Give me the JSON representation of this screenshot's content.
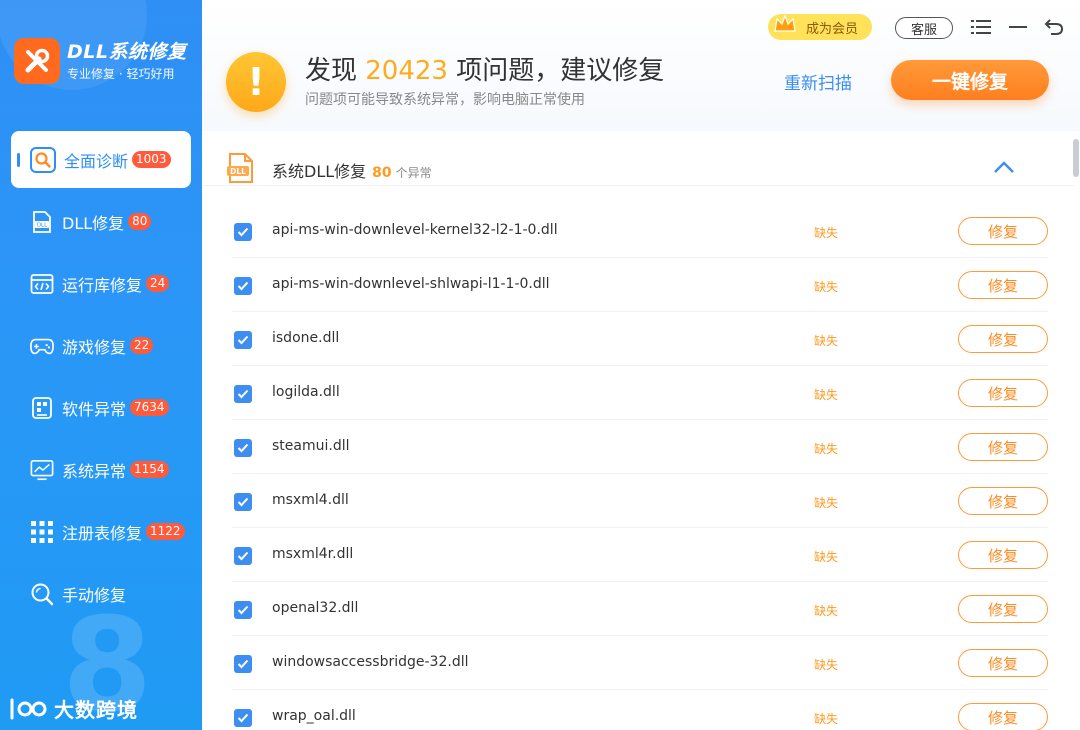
{
  "app": {
    "title": "DLL系统修复",
    "subtitle": "专业修复 · 轻巧好用"
  },
  "colors": {
    "sidebar": "#2f8ff5",
    "accent_orange": "#ff8a1f",
    "badge_red": "#ff5a3c",
    "link_blue": "#3c8ef0"
  },
  "sidebar": {
    "items": [
      {
        "label": "全面诊断",
        "badge": "1003",
        "icon": "search-icon",
        "active": true
      },
      {
        "label": "DLL修复",
        "badge": "80",
        "icon": "dll-file-icon"
      },
      {
        "label": "运行库修复",
        "badge": "24",
        "icon": "code-window-icon"
      },
      {
        "label": "游戏修复",
        "badge": "22",
        "icon": "gamepad-icon"
      },
      {
        "label": "软件异常",
        "badge": "7634",
        "icon": "software-icon"
      },
      {
        "label": "系统异常",
        "badge": "1154",
        "icon": "monitor-icon"
      },
      {
        "label": "注册表修复",
        "badge": "1122",
        "icon": "grid-icon"
      },
      {
        "label": "手动修复",
        "badge": "",
        "icon": "magnifier-icon"
      }
    ],
    "decor_number": "8",
    "watermark": "大数跨境"
  },
  "header": {
    "headline_prefix": "发现 ",
    "issue_count": "20423",
    "headline_suffix": " 项问题，建议修复",
    "subline": "问题项可能导致系统异常，影响电脑正常使用",
    "rescan_label": "重新扫描",
    "fix_all_label": "一键修复",
    "vip_label": "成为会员",
    "service_label": "客服"
  },
  "section": {
    "title": "系统DLL修复",
    "count": "80",
    "unit": "个异常"
  },
  "rows": [
    {
      "name": "api-ms-win-downlevel-kernel32-l2-1-0.dll",
      "status": "缺失",
      "action": "修复"
    },
    {
      "name": "api-ms-win-downlevel-shlwapi-l1-1-0.dll",
      "status": "缺失",
      "action": "修复"
    },
    {
      "name": "isdone.dll",
      "status": "缺失",
      "action": "修复"
    },
    {
      "name": "logilda.dll",
      "status": "缺失",
      "action": "修复"
    },
    {
      "name": "steamui.dll",
      "status": "缺失",
      "action": "修复"
    },
    {
      "name": "msxml4.dll",
      "status": "缺失",
      "action": "修复"
    },
    {
      "name": "msxml4r.dll",
      "status": "缺失",
      "action": "修复"
    },
    {
      "name": "openal32.dll",
      "status": "缺失",
      "action": "修复"
    },
    {
      "name": "windowsaccessbridge-32.dll",
      "status": "缺失",
      "action": "修复"
    },
    {
      "name": "wrap_oal.dll",
      "status": "缺失",
      "action": "修复"
    }
  ]
}
